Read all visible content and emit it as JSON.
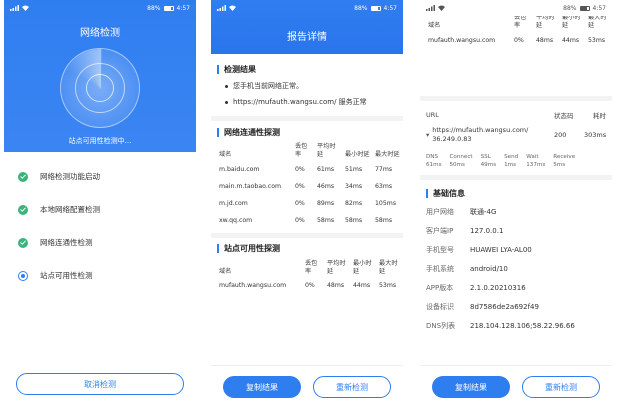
{
  "status": {
    "battery": "88%",
    "time": "4:57"
  },
  "screen1": {
    "title": "网络检测",
    "checking_text": "站点可用性检测中...",
    "steps": [
      {
        "label": "网络检测功能启动",
        "state": "done"
      },
      {
        "label": "本地网络配置检测",
        "state": "done"
      },
      {
        "label": "网络连通性检测",
        "state": "done"
      },
      {
        "label": "站点可用性检测",
        "state": "running"
      }
    ],
    "cancel_label": "取消检测"
  },
  "screen2": {
    "title": "报告详情",
    "result_title": "检测结果",
    "results": [
      "您手机当前网络正常。",
      "https://mufauth.wangsu.com/ 服务正常"
    ],
    "conn_title": "网络连通性探测",
    "conn_headers": [
      "域名",
      "丢包率",
      "平均时延",
      "最小时延",
      "最大时延"
    ],
    "conn_rows": [
      [
        "m.baidu.com",
        "0%",
        "61ms",
        "51ms",
        "77ms"
      ],
      [
        "main.m.taobao.com",
        "0%",
        "46ms",
        "34ms",
        "63ms"
      ],
      [
        "m.jd.com",
        "0%",
        "89ms",
        "82ms",
        "105ms"
      ],
      [
        "xw.qq.com",
        "0%",
        "58ms",
        "58ms",
        "58ms"
      ]
    ],
    "site_title": "站点可用性探测",
    "site_headers": [
      "域名",
      "丢包率",
      "平均时延",
      "最小时延",
      "最大时延"
    ],
    "site_rows": [
      [
        "mufauth.wangsu.com",
        "0%",
        "48ms",
        "44ms",
        "53ms"
      ]
    ],
    "copy_label": "复制结果",
    "retest_label": "重新检测"
  },
  "screen3": {
    "top_headers": [
      "域名",
      "丢包率",
      "平均时延",
      "最小时延",
      "最大时延"
    ],
    "top_row": [
      "mufauth.wangsu.com",
      "0%",
      "48ms",
      "44ms",
      "53ms"
    ],
    "url_headers": [
      "URL",
      "状态码",
      "耗时"
    ],
    "url_value": "https://mufauth.wangsu.com/ 36.249.0.83",
    "url_status": "200",
    "url_time": "303ms",
    "timing": [
      {
        "name": "DNS",
        "value": "61ms"
      },
      {
        "name": "Connect",
        "value": "50ms"
      },
      {
        "name": "SSL",
        "value": "49ms"
      },
      {
        "name": "Send",
        "value": "1ms"
      },
      {
        "name": "Wait",
        "value": "137ms"
      },
      {
        "name": "Receive",
        "value": "5ms"
      }
    ],
    "basic_title": "基础信息",
    "basic": [
      {
        "k": "用户网络",
        "v": "联通-4G"
      },
      {
        "k": "客户端IP",
        "v": "127.0.0.1"
      },
      {
        "k": "手机型号",
        "v": "HUAWEI LYA-AL00"
      },
      {
        "k": "手机系统",
        "v": "android/10"
      },
      {
        "k": "APP版本",
        "v": "2.1.0.20210316"
      },
      {
        "k": "设备标识",
        "v": "8d7586de2a692f49"
      },
      {
        "k": "DNS列表",
        "v": "218.104.128.106;58.22.96.66"
      }
    ],
    "copy_label": "复制结果",
    "retest_label": "重新检测"
  },
  "colors": {
    "primary": "#2f7ef0",
    "success": "#3bb37a"
  }
}
